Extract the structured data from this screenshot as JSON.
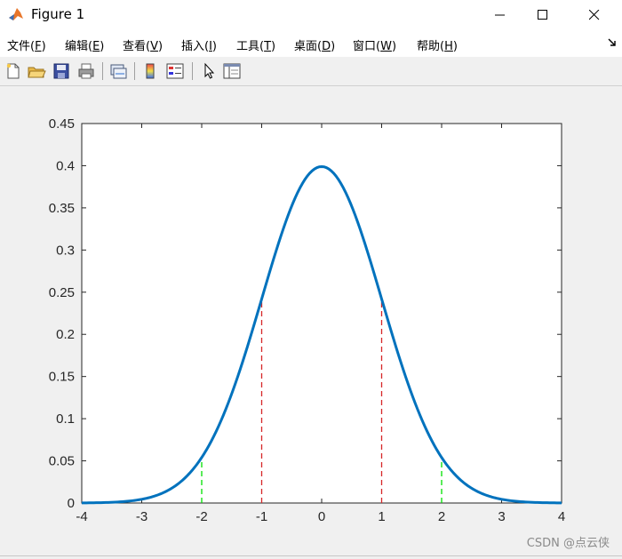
{
  "window": {
    "title": "Figure 1"
  },
  "menu": [
    {
      "label": "文件(",
      "key": "F",
      "end": ")"
    },
    {
      "label": "编辑(",
      "key": "E",
      "end": ")"
    },
    {
      "label": "查看(",
      "key": "V",
      "end": ")"
    },
    {
      "label": "插入(",
      "key": "I",
      "end": ")"
    },
    {
      "label": "工具(",
      "key": "T",
      "end": ")"
    },
    {
      "label": "桌面(",
      "key": "D",
      "end": ")"
    },
    {
      "label": "窗口(",
      "key": "W",
      "end": ")"
    },
    {
      "label": "帮助(",
      "key": "H",
      "end": ")"
    }
  ],
  "toolbar_icons": [
    "new-figure-icon",
    "open-file-icon",
    "save-icon",
    "print-icon",
    "link-plot-icon",
    "colorbar-icon",
    "legend-icon",
    "edit-plot-arrow-icon",
    "property-inspector-icon"
  ],
  "watermark": "CSDN @点云侠",
  "colors": {
    "curve": "#0072bd",
    "sigma1": "#d62728",
    "sigma2": "#00e000"
  },
  "chart_data": {
    "type": "line",
    "title": "",
    "xlabel": "",
    "ylabel": "",
    "xlim": [
      -4,
      4
    ],
    "ylim": [
      0,
      0.45
    ],
    "xticks": [
      "-4",
      "-3",
      "-2",
      "-1",
      "0",
      "1",
      "2",
      "3",
      "4"
    ],
    "yticks": [
      "0",
      "0.05",
      "0.1",
      "0.15",
      "0.2",
      "0.25",
      "0.3",
      "0.35",
      "0.4",
      "0.45"
    ],
    "grid": false,
    "series": [
      {
        "x": [
          -4,
          -3.5,
          -3,
          -2.5,
          -2,
          -1.5,
          -1,
          -0.5,
          0,
          0.5,
          1,
          1.5,
          2,
          2.5,
          3,
          3.5,
          4
        ],
        "y": [
          0.0001,
          0.0009,
          0.0044,
          0.0175,
          0.054,
          0.1295,
          0.242,
          0.3521,
          0.3989,
          0.3521,
          0.242,
          0.1295,
          0.054,
          0.0175,
          0.0044,
          0.0009,
          0.0001
        ]
      }
    ],
    "vlines": [
      {
        "x": -1,
        "y": 0.242,
        "color": "red",
        "style": "dashed"
      },
      {
        "x": 1,
        "y": 0.242,
        "color": "red",
        "style": "dashed"
      },
      {
        "x": -2,
        "y": 0.054,
        "color": "green",
        "style": "dashed"
      },
      {
        "x": 2,
        "y": 0.054,
        "color": "green",
        "style": "dashed"
      }
    ]
  }
}
